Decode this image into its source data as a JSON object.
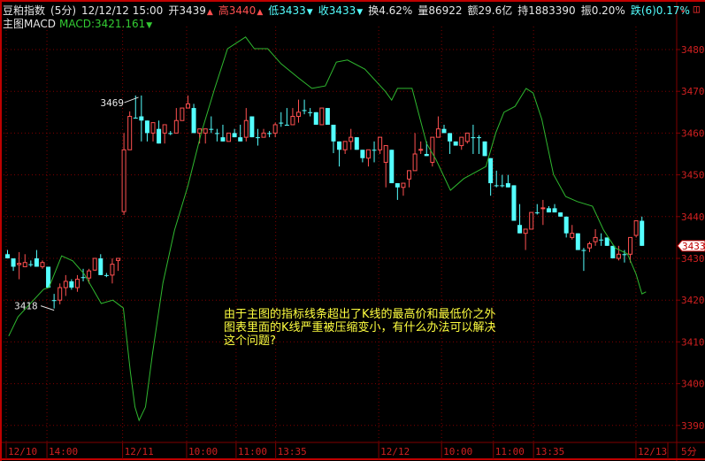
{
  "header": {
    "instrument": "豆粕指数",
    "period": "(5分)",
    "datetime": "12/12/12 15:00",
    "open": "开3439",
    "high": "高3440",
    "low": "低3433",
    "close": "收3433",
    "turnover": "换4.62%",
    "volume": "量86922",
    "amount": "额29.6亿",
    "open_interest": "持1883390",
    "amplitude": "振0.20%",
    "change": "跌(6)0.17%",
    "up_arrow": "▲",
    "down_arrow": "▼"
  },
  "indicator": {
    "name": "主图MACD",
    "value": "MACD:3421.161",
    "arrow": "▼"
  },
  "note": {
    "lines": [
      "由于主图的指标线条超出了K线的最高价和最低价之外",
      "图表里面的K线严重被压缩变小，有什么办法可以解决",
      "这个问题?"
    ]
  },
  "icons": {
    "left": "download-arrow-icon",
    "right": "window-icon"
  },
  "colors": {
    "up": "#ff5050",
    "down": "#54ffff",
    "macd": "#2fb82f",
    "grid": "#800000",
    "axis_text": "#d02020",
    "note": "#ffff40"
  },
  "chart_data": {
    "type": "candlestick",
    "title": "豆粕指数 (5分)",
    "ylim": [
      3387,
      3485
    ],
    "yticks": [
      3390,
      3400,
      3410,
      3420,
      3430,
      3440,
      3450,
      3460,
      3470,
      3480
    ],
    "ytick_labels": [
      "3390",
      "3400",
      "3410",
      "3420",
      "3430",
      "3440",
      "3450",
      "3460",
      "3470",
      "3480"
    ],
    "last_price_label": "3433",
    "last_price": 3433,
    "xticks": [
      {
        "bar": 0,
        "label": "12/10"
      },
      {
        "bar": 7,
        "label": "14:00"
      },
      {
        "bar": 20,
        "label": "12/11"
      },
      {
        "bar": 31,
        "label": "10:00"
      },
      {
        "bar": 39.5,
        "label": "11:00"
      },
      {
        "bar": 46.3,
        "label": "13:35"
      },
      {
        "bar": 64,
        "label": "12/12"
      },
      {
        "bar": 74.8,
        "label": "10:00"
      },
      {
        "bar": 83.7,
        "label": "11:00"
      },
      {
        "bar": 90.6,
        "label": "13:35"
      },
      {
        "bar": 108.2,
        "label": "12/13"
      }
    ],
    "period_label": "5分",
    "annotations": [
      {
        "bar": 22.5,
        "price": 3469,
        "label": "3469"
      },
      {
        "bar": 8,
        "price": 3418,
        "label": "3418"
      }
    ],
    "ohlc": [
      [
        3431,
        3432,
        3430,
        3430
      ],
      [
        3430,
        3430,
        3427,
        3428
      ],
      [
        3428.5,
        3431.5,
        3425,
        3428.8
      ],
      [
        3428,
        3431,
        3428,
        3429
      ],
      [
        3428.6,
        3429.5,
        3428,
        3428.6
      ],
      [
        3430,
        3432,
        3428,
        3428
      ],
      [
        3428,
        3429.5,
        3427.5,
        3429
      ],
      [
        3428,
        3428,
        3423,
        3423
      ],
      [
        3420,
        3421.5,
        3418,
        3420
      ],
      [
        3420,
        3424,
        3419,
        3423
      ],
      [
        3423,
        3426,
        3421,
        3424.5
      ],
      [
        3424.5,
        3425,
        3422.5,
        3423
      ],
      [
        3423,
        3426,
        3422,
        3425
      ],
      [
        3425.5,
        3427.5,
        3424.5,
        3425.5
      ],
      [
        3425.3,
        3427.5,
        3424,
        3427
      ],
      [
        3427.2,
        3430,
        3427,
        3430
      ],
      [
        3430,
        3431,
        3426,
        3426
      ],
      [
        3426,
        3426.5,
        3425.5,
        3426
      ],
      [
        3426,
        3430,
        3424,
        3428.6
      ],
      [
        3429.5,
        3430,
        3427,
        3430
      ],
      [
        3441.2,
        3460,
        3440.4,
        3456
      ],
      [
        3456,
        3465.2,
        3456,
        3464
      ],
      [
        3463.7,
        3469,
        3463.5,
        3463.7
      ],
      [
        3464,
        3469,
        3458,
        3463
      ],
      [
        3463,
        3463,
        3458,
        3460
      ],
      [
        3460,
        3462.5,
        3458,
        3462.5
      ],
      [
        3461,
        3463,
        3457.5,
        3457.5
      ],
      [
        3460,
        3462,
        3457.5,
        3462
      ],
      [
        3460,
        3460.5,
        3459.5,
        3460
      ],
      [
        3460,
        3466,
        3460,
        3463
      ],
      [
        3463,
        3466,
        3463,
        3466
      ],
      [
        3466,
        3469,
        3466,
        3467
      ],
      [
        3466,
        3467,
        3460,
        3460
      ],
      [
        3460,
        3461,
        3457.5,
        3461
      ],
      [
        3460,
        3461,
        3457.5,
        3461
      ],
      [
        3461,
        3464,
        3460,
        3461
      ],
      [
        3460,
        3461,
        3458,
        3460
      ],
      [
        3459,
        3462,
        3458,
        3458
      ],
      [
        3458,
        3460,
        3458,
        3460
      ],
      [
        3460,
        3461,
        3459,
        3459
      ],
      [
        3459,
        3462,
        3458,
        3458
      ],
      [
        3459,
        3466,
        3458,
        3463
      ],
      [
        3464,
        3464,
        3459,
        3459
      ],
      [
        3459,
        3461,
        3457,
        3459
      ],
      [
        3459,
        3461,
        3459,
        3460
      ],
      [
        3460,
        3460.5,
        3459,
        3460
      ],
      [
        3460,
        3462.5,
        3459,
        3462
      ],
      [
        3462.5,
        3465,
        3461.5,
        3462.5
      ],
      [
        3462,
        3466,
        3462,
        3462
      ],
      [
        3462,
        3466,
        3462,
        3464
      ],
      [
        3464,
        3468,
        3462.5,
        3465
      ],
      [
        3465.5,
        3468,
        3464.5,
        3465.5
      ],
      [
        3465,
        3466,
        3464,
        3465
      ],
      [
        3465,
        3465,
        3462,
        3462
      ],
      [
        3462,
        3466,
        3462,
        3466
      ],
      [
        3466,
        3466,
        3462,
        3462
      ],
      [
        3462,
        3462,
        3455.2,
        3458
      ],
      [
        3458,
        3458,
        3452,
        3456
      ],
      [
        3456,
        3458,
        3455,
        3458
      ],
      [
        3458,
        3461,
        3456,
        3459
      ],
      [
        3459,
        3459,
        3456,
        3456
      ],
      [
        3456,
        3456,
        3453,
        3454
      ],
      [
        3454,
        3456,
        3452,
        3456
      ],
      [
        3456,
        3458,
        3453,
        3456
      ],
      [
        3456,
        3459,
        3455,
        3459
      ],
      [
        3453,
        3457,
        3447,
        3457
      ],
      [
        3456,
        3456,
        3448,
        3448
      ],
      [
        3448,
        3448,
        3444,
        3447
      ],
      [
        3447,
        3448,
        3445,
        3448
      ],
      [
        3449,
        3451,
        3447,
        3451
      ],
      [
        3451,
        3460,
        3451,
        3455
      ],
      [
        3456,
        3458,
        3455,
        3456.1
      ],
      [
        3455,
        3458,
        3454.5,
        3454.5
      ],
      [
        3453,
        3459,
        3452,
        3459
      ],
      [
        3459,
        3464,
        3459,
        3461
      ],
      [
        3461,
        3462,
        3460,
        3460
      ],
      [
        3460,
        3460,
        3455,
        3458
      ],
      [
        3458,
        3458,
        3457,
        3457
      ],
      [
        3457,
        3459,
        3456,
        3459
      ],
      [
        3458,
        3460,
        3457.5,
        3460
      ],
      [
        3459,
        3462,
        3455,
        3459
      ],
      [
        3459,
        3459.5,
        3455,
        3459
      ],
      [
        3458,
        3458,
        3454.5,
        3454.5
      ],
      [
        3454,
        3454,
        3445,
        3448
      ],
      [
        3447.5,
        3451,
        3447,
        3447.5
      ],
      [
        3447.5,
        3450,
        3447,
        3447.5
      ],
      [
        3448,
        3450,
        3447,
        3447
      ],
      [
        3447.5,
        3447.5,
        3439,
        3439
      ],
      [
        3438,
        3443,
        3436,
        3436
      ],
      [
        3436,
        3437,
        3432,
        3437
      ],
      [
        3437,
        3441,
        3437,
        3441
      ],
      [
        3441,
        3443,
        3440.5,
        3441
      ],
      [
        3442,
        3444,
        3438,
        3442.1
      ],
      [
        3442,
        3442.5,
        3441,
        3441
      ],
      [
        3442,
        3443,
        3441,
        3441
      ],
      [
        3441,
        3441,
        3440,
        3440
      ],
      [
        3440,
        3440,
        3435,
        3436
      ],
      [
        3435,
        3438,
        3434.5,
        3436
      ],
      [
        3436,
        3436,
        3432,
        3432
      ],
      [
        3432,
        3432.5,
        3427,
        3432
      ],
      [
        3432.5,
        3434,
        3431.5,
        3433.5
      ],
      [
        3434,
        3437,
        3433,
        3435
      ],
      [
        3434.5,
        3436,
        3433,
        3434.5
      ],
      [
        3435,
        3435,
        3433,
        3433
      ],
      [
        3433,
        3433,
        3430,
        3430
      ],
      [
        3430,
        3433,
        3429.5,
        3431
      ],
      [
        3431,
        3432,
        3429,
        3431
      ],
      [
        3431,
        3435,
        3429,
        3435
      ],
      [
        3435.5,
        3439,
        3435,
        3439
      ],
      [
        3439,
        3440,
        3433,
        3433
      ]
    ],
    "series": [
      {
        "name": "MACD",
        "points": [
          [
            0.2,
            3411.4
          ],
          [
            1.8,
            3416.0
          ],
          [
            6.2,
            3422.6
          ],
          [
            7.1,
            3423.0
          ],
          [
            9.3,
            3430.6
          ],
          [
            11.2,
            3429.4
          ],
          [
            13.2,
            3426.2
          ],
          [
            16.1,
            3419.2
          ],
          [
            18.1,
            3420.0
          ],
          [
            19.9,
            3418.1
          ],
          [
            21.1,
            3402.9
          ],
          [
            21.9,
            3394.4
          ],
          [
            22.6,
            3391.2
          ],
          [
            23.7,
            3394.4
          ],
          [
            24.9,
            3407.1
          ],
          [
            26.7,
            3424.1
          ],
          [
            28.7,
            3436.8
          ],
          [
            31,
            3447.4
          ],
          [
            33.3,
            3460.1
          ],
          [
            35.6,
            3470.7
          ],
          [
            37.8,
            3480.2
          ],
          [
            40.9,
            3483.0
          ],
          [
            42.4,
            3480.2
          ],
          [
            44.7,
            3480.2
          ],
          [
            47,
            3476.6
          ],
          [
            50,
            3473.2
          ],
          [
            52.3,
            3470.7
          ],
          [
            54.6,
            3471.3
          ],
          [
            56.5,
            3477.0
          ],
          [
            58.4,
            3477.5
          ],
          [
            61.4,
            3475.3
          ],
          [
            64.9,
            3470.0
          ],
          [
            66,
            3467.9
          ],
          [
            67,
            3470.7
          ],
          [
            69.5,
            3470.7
          ],
          [
            72,
            3457.5
          ],
          [
            73.6,
            3453.7
          ],
          [
            76.1,
            3446.3
          ],
          [
            78.4,
            3449.1
          ],
          [
            82.2,
            3452.0
          ],
          [
            83.9,
            3460.1
          ],
          [
            85.3,
            3465.0
          ],
          [
            87.2,
            3466.4
          ],
          [
            89.1,
            3470.7
          ],
          [
            90.3,
            3469.6
          ],
          [
            91.8,
            3463.3
          ],
          [
            93.8,
            3450.1
          ],
          [
            95.9,
            3444.8
          ],
          [
            97.9,
            3443.6
          ],
          [
            100.5,
            3442.5
          ],
          [
            102.4,
            3436.8
          ],
          [
            104.4,
            3432.5
          ],
          [
            106.5,
            3431.1
          ],
          [
            108,
            3426.2
          ],
          [
            109,
            3421.5
          ],
          [
            109.7,
            3422.0
          ]
        ]
      }
    ]
  }
}
